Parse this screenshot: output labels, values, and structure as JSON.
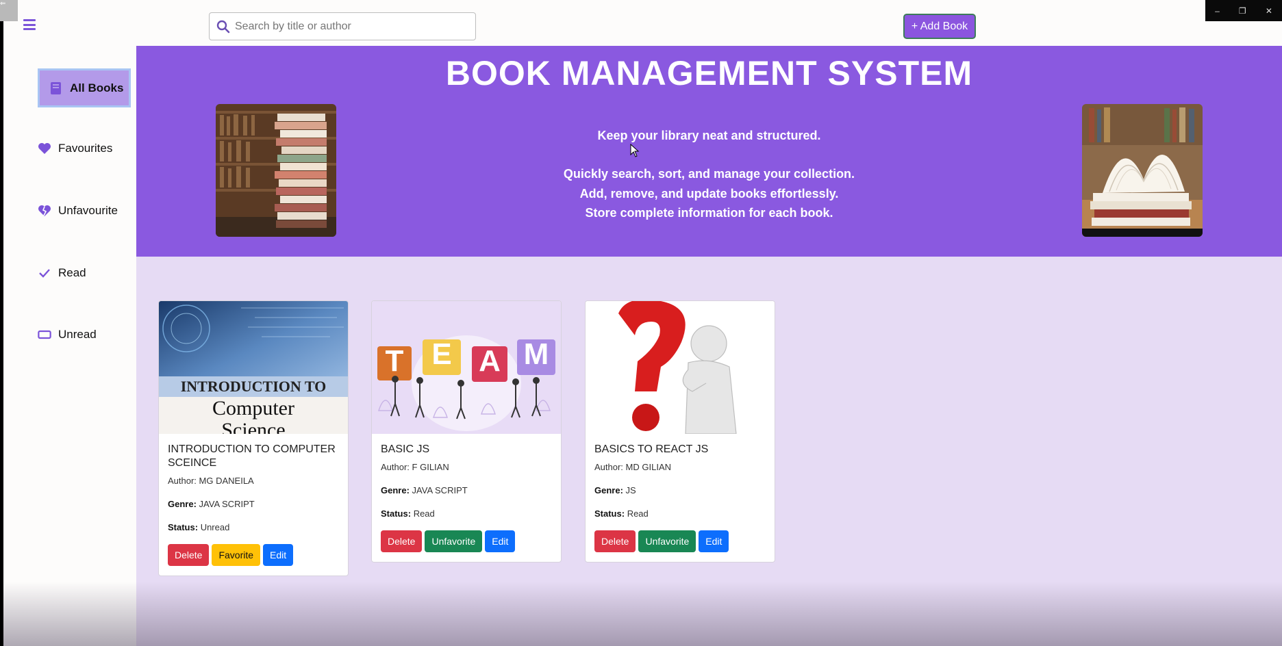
{
  "colors": {
    "accent": "#8a59e0",
    "content_bg": "#e6dbf4",
    "danger": "#dc3545",
    "success": "#198754",
    "warning": "#ffc107",
    "primary": "#0d6efd"
  },
  "window": {
    "minimize": "–",
    "restore": "❐",
    "close": "✕"
  },
  "header": {
    "menu_icon": "hamburger-menu-icon",
    "search": {
      "placeholder": "Search by title or author",
      "value": "",
      "icon": "search-icon"
    },
    "add_button_label": "+ Add Book"
  },
  "sidebar": {
    "items": [
      {
        "label": "All Books",
        "icon": "book-icon",
        "active": true
      },
      {
        "label": "Favourites",
        "icon": "heart-icon"
      },
      {
        "label": "Unfavourite",
        "icon": "broken-heart-icon"
      },
      {
        "label": "Read",
        "icon": "check-icon"
      },
      {
        "label": "Unread",
        "icon": "rectangle-icon"
      }
    ]
  },
  "hero": {
    "title": "BOOK MANAGEMENT SYSTEM",
    "tagline": "Keep your library neat and structured.",
    "lines": [
      "Quickly search, sort, and manage your collection.",
      "Add, remove, and update books effortlessly.",
      "Store complete information for each book."
    ]
  },
  "books": [
    {
      "title": "INTRODUCTION TO COMPUTER SCEINCE",
      "cover_text_1": "INTRODUCTION TO",
      "cover_text_2": "Computer",
      "cover_text_3": "Science",
      "author_label": "Author:",
      "author": "MG DANEILA",
      "genre_label": "Genre:",
      "genre": "JAVA SCRIPT",
      "status_label": "Status:",
      "status": "Unread",
      "buttons": {
        "delete": "Delete",
        "fav": "Favorite",
        "edit": "Edit"
      }
    },
    {
      "title": "BASIC JS",
      "cover_letters": [
        "T",
        "E",
        "A",
        "M"
      ],
      "author_label": "Author:",
      "author": "F GILIAN",
      "genre_label": "Genre:",
      "genre": "JAVA SCRIPT",
      "status_label": "Status:",
      "status": "Read",
      "buttons": {
        "delete": "Delete",
        "fav": "Unfavorite",
        "edit": "Edit"
      }
    },
    {
      "title": "BASICS TO REACT JS",
      "author_label": "Author:",
      "author": "MD GILIAN",
      "genre_label": "Genre:",
      "genre": "JS",
      "status_label": "Status:",
      "status": "Read",
      "buttons": {
        "delete": "Delete",
        "fav": "Unfavorite",
        "edit": "Edit"
      }
    }
  ]
}
